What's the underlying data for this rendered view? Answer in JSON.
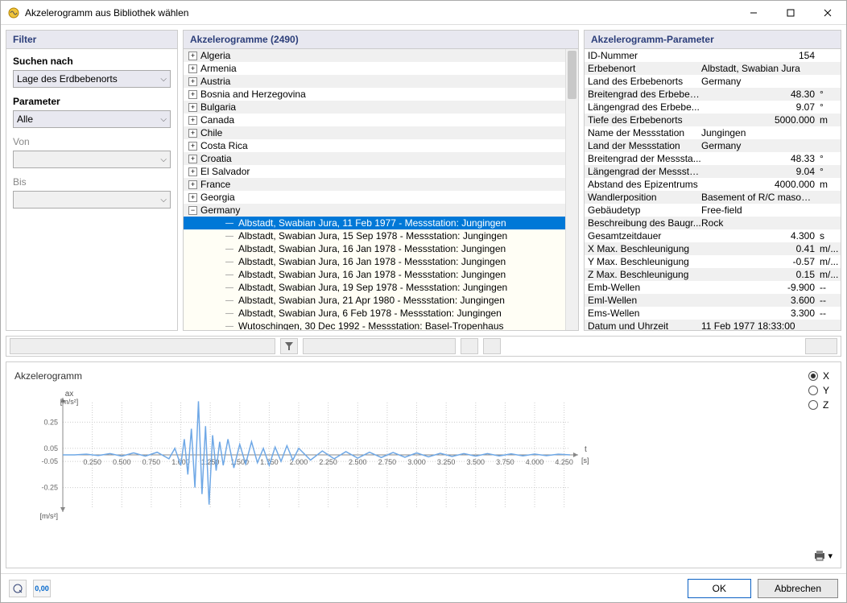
{
  "window": {
    "title": "Akzelerogramm aus Bibliothek wählen"
  },
  "filter": {
    "header": "Filter",
    "search_label": "Suchen nach",
    "search_value": "Lage des Erdbebenorts",
    "param_label": "Parameter",
    "param_value": "Alle",
    "von_label": "Von",
    "bis_label": "Bis"
  },
  "tree": {
    "header": "Akzelerogramme (2490)",
    "countries": [
      "Algeria",
      "Armenia",
      "Austria",
      "Bosnia and Herzegovina",
      "Bulgaria",
      "Canada",
      "Chile",
      "Costa Rica",
      "Croatia",
      "El Salvador",
      "France",
      "Georgia",
      "Germany"
    ],
    "germany_children": [
      "Albstadt, Swabian Jura, 11 Feb 1977 - Messstation: Jungingen",
      "Albstadt, Swabian Jura, 15 Sep 1978 - Messstation: Jungingen",
      "Albstadt, Swabian Jura, 16 Jan 1978 - Messstation: Jungingen",
      "Albstadt, Swabian Jura, 16 Jan 1978 - Messstation: Jungingen",
      "Albstadt, Swabian Jura, 16 Jan 1978 - Messstation: Jungingen",
      "Albstadt, Swabian Jura, 19 Sep 1978 - Messstation: Jungingen",
      "Albstadt, Swabian Jura, 21 Apr 1980 - Messstation: Jungingen",
      "Albstadt, Swabian Jura, 6 Feb 1978 - Messstation: Jungingen",
      "Wutoschingen, 30 Dec 1992 - Messstation: Basel-Tropenhaus"
    ],
    "selected_index": 0
  },
  "params": {
    "header": "Akzelerogramm-Parameter",
    "rows": [
      {
        "k": "ID-Nummer",
        "v": "154",
        "align": "right",
        "u": ""
      },
      {
        "k": "Erbebenort",
        "v": "Albstadt, Swabian Jura",
        "align": "left",
        "u": ""
      },
      {
        "k": "Land des Erbebenorts",
        "v": "Germany",
        "align": "left",
        "u": ""
      },
      {
        "k": "Breitengrad des Erbeben...",
        "v": "48.30",
        "align": "right",
        "u": "°"
      },
      {
        "k": "Längengrad des Erbebe...",
        "v": "9.07",
        "align": "right",
        "u": "°"
      },
      {
        "k": "Tiefe des Erbebenorts",
        "v": "5000.000",
        "align": "right",
        "u": "m"
      },
      {
        "k": "Name der Messstation",
        "v": "Jungingen",
        "align": "left",
        "u": ""
      },
      {
        "k": "Land der Messstation",
        "v": "Germany",
        "align": "left",
        "u": ""
      },
      {
        "k": "Breitengrad der Messsta...",
        "v": "48.33",
        "align": "right",
        "u": "°"
      },
      {
        "k": "Längengrad der Messsta...",
        "v": "9.04",
        "align": "right",
        "u": "°"
      },
      {
        "k": "Abstand des Epizentrums",
        "v": "4000.000",
        "align": "right",
        "u": "m"
      },
      {
        "k": "Wandlerposition",
        "v": "Basement of R/C masonr...",
        "align": "left",
        "u": ""
      },
      {
        "k": "Gebäudetyp",
        "v": "Free-field",
        "align": "left",
        "u": ""
      },
      {
        "k": "Beschreibung des Baugr...",
        "v": "Rock",
        "align": "left",
        "u": ""
      },
      {
        "k": "Gesamtzeitdauer",
        "v": "4.300",
        "align": "right",
        "u": "s"
      },
      {
        "k": "X Max. Beschleunigung",
        "v": "0.41",
        "align": "right",
        "u": "m/..."
      },
      {
        "k": "Y Max. Beschleunigung",
        "v": "-0.57",
        "align": "right",
        "u": "m/..."
      },
      {
        "k": "Z Max. Beschleunigung",
        "v": "0.15",
        "align": "right",
        "u": "m/..."
      },
      {
        "k": "Emb-Wellen",
        "v": "-9.900",
        "align": "right",
        "u": "--"
      },
      {
        "k": "Eml-Wellen",
        "v": "3.600",
        "align": "right",
        "u": "--"
      },
      {
        "k": "Ems-Wellen",
        "v": "3.300",
        "align": "right",
        "u": "--"
      },
      {
        "k": "Datum und Uhrzeit",
        "v": "11 Feb 1977 18:33:00",
        "align": "left",
        "u": ""
      }
    ]
  },
  "chart": {
    "title": "Akzelerogramm",
    "y_axis_label": "ax",
    "y_axis_unit": "[m/s²]",
    "x_axis_label": "t",
    "x_axis_unit": "[s]",
    "axes": {
      "options": [
        "X",
        "Y",
        "Z"
      ],
      "selected": "X"
    }
  },
  "chart_data": {
    "type": "line",
    "title": "Akzelerogramm",
    "xlabel": "t [s]",
    "ylabel": "ax [m/s²]",
    "xlim": [
      0,
      4.3
    ],
    "ylim": [
      -0.4,
      0.4
    ],
    "x_ticks": [
      0.25,
      0.5,
      0.75,
      1.0,
      1.25,
      1.5,
      1.75,
      2.0,
      2.25,
      2.5,
      2.75,
      3.0,
      3.25,
      3.5,
      3.75,
      4.0,
      4.25
    ],
    "y_ticks": [
      -0.25,
      -0.05,
      0.05,
      0.25
    ],
    "series": [
      {
        "name": "ax",
        "x": [
          0.0,
          0.1,
          0.2,
          0.3,
          0.4,
          0.5,
          0.6,
          0.7,
          0.8,
          0.9,
          0.95,
          1.0,
          1.03,
          1.06,
          1.09,
          1.12,
          1.15,
          1.18,
          1.21,
          1.24,
          1.27,
          1.3,
          1.33,
          1.36,
          1.4,
          1.45,
          1.5,
          1.55,
          1.6,
          1.65,
          1.7,
          1.75,
          1.8,
          1.85,
          1.9,
          1.95,
          2.0,
          2.1,
          2.2,
          2.3,
          2.4,
          2.5,
          2.6,
          2.7,
          2.8,
          2.9,
          3.0,
          3.1,
          3.2,
          3.3,
          3.4,
          3.5,
          3.6,
          3.7,
          3.8,
          3.9,
          4.0,
          4.1,
          4.2,
          4.3
        ],
        "y": [
          0.0,
          0.0,
          0.005,
          -0.005,
          0.01,
          -0.01,
          0.015,
          -0.01,
          0.02,
          -0.03,
          0.05,
          -0.08,
          0.12,
          -0.15,
          0.2,
          -0.25,
          0.41,
          -0.3,
          0.22,
          -0.38,
          0.15,
          -0.12,
          0.1,
          -0.08,
          0.12,
          -0.1,
          0.08,
          -0.07,
          0.1,
          -0.06,
          0.05,
          -0.08,
          0.06,
          -0.05,
          0.07,
          -0.04,
          0.05,
          -0.04,
          0.03,
          -0.03,
          0.025,
          -0.025,
          0.02,
          -0.02,
          0.018,
          -0.018,
          0.015,
          -0.015,
          0.012,
          -0.012,
          0.01,
          -0.01,
          0.01,
          -0.008,
          0.008,
          -0.008,
          0.006,
          -0.006,
          0.005,
          0.0
        ]
      }
    ]
  },
  "footer": {
    "ok": "OK",
    "cancel": "Abbrechen"
  }
}
